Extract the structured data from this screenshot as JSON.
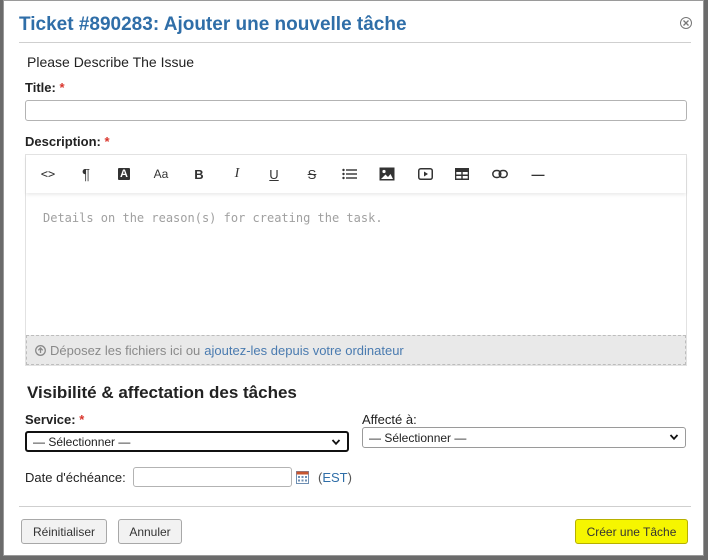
{
  "dialog": {
    "title": "Ticket #890283: Ajouter une nouvelle tâche",
    "intro": "Please Describe The Issue"
  },
  "form": {
    "title_label": "Title:",
    "required_mark": "*",
    "title_value": "",
    "description_label": "Description:",
    "editor_placeholder": "Details on the reason(s) for creating the task.",
    "toolbar": [
      "code-view",
      "paragraph",
      "text-color",
      "font-size",
      "bold",
      "italic",
      "underline",
      "strikethrough",
      "list",
      "image",
      "video",
      "table",
      "link",
      "horizontal-rule"
    ],
    "toolbar_glyphs": {
      "code": "<>",
      "paragraph": "¶",
      "text_color": "A",
      "font_size": "Aa",
      "bold": "B",
      "italic": "I",
      "underline": "U",
      "strike": "S",
      "hr": "—"
    },
    "dropzone_text": "Déposez les fichiers ici ou",
    "dropzone_link": "ajoutez-les depuis votre ordinateur"
  },
  "assignment": {
    "section_title": "Visibilité & affectation des tâches",
    "service_label": "Service:",
    "service_value": "— Sélectionner —",
    "assigned_label": "Affecté à:",
    "assigned_value": "— Sélectionner —",
    "due_label": "Date d'échéance:",
    "due_value": "",
    "tz_open": "(",
    "tz": "EST",
    "tz_close": ")"
  },
  "buttons": {
    "reset": "Réinitialiser",
    "cancel": "Annuler",
    "create": "Créer une Tâche"
  },
  "colors": {
    "title": "#2f6ea8",
    "required": "#d9342b",
    "primary_button": "#f6f600"
  }
}
